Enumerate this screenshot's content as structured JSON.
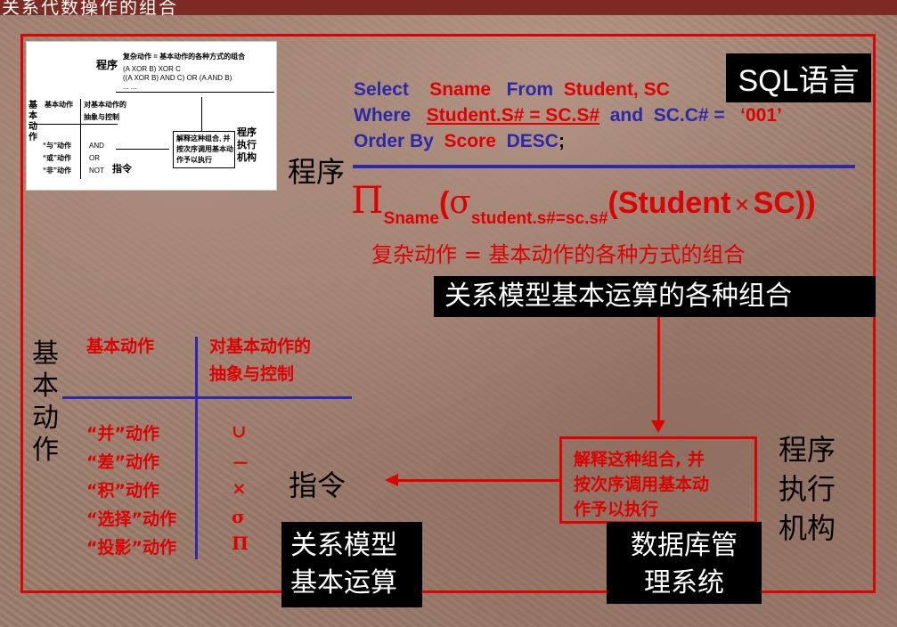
{
  "title_bar": "关系代数操作的组合",
  "sql_badge": "SQL语言",
  "sql": {
    "line1": {
      "k1": "Select",
      "v1": "Sname",
      "k2": "From",
      "v2": "Student, SC"
    },
    "line2": {
      "k1": "Where",
      "v1": "Student.S# = SC.S#",
      "k2": "and",
      "v2": "SC.C# =",
      "v3": "‘001’"
    },
    "line3": {
      "k1": "Order By",
      "v1": "Score",
      "k2": "DESC",
      "end": ";"
    }
  },
  "program_label": "程序",
  "formula": {
    "pi": "Π",
    "pi_sub": "Sname",
    "open": "(",
    "sigma": "σ",
    "sigma_sub": "student.s#=sc.s#",
    "inner_open": "(Student",
    "times": "×",
    "inner_close": "SC))"
  },
  "complex_action": "复杂动作 = 基本动作的各种方式的组合",
  "relational_combination": "关系模型基本运算的各种组合",
  "interpret_box": [
    "解释这种组合, 并",
    "按次序调用基本动",
    "作予以执行"
  ],
  "exec_org": [
    "程序",
    "执行",
    "机构"
  ],
  "instruction": "指令",
  "dbms": [
    "数据库管",
    "理系统"
  ],
  "rel_basic_ops": [
    "关系模型",
    "基本运算"
  ],
  "basic_action_vertical": [
    "基",
    "本",
    "动",
    "作"
  ],
  "table_header_left": "基本动作",
  "table_header_right": [
    "对基本动作的",
    "抽象与控制"
  ],
  "ops": [
    {
      "name": "“并”动作",
      "symbol": "∪"
    },
    {
      "name": "“差”动作",
      "symbol": "－"
    },
    {
      "name": "“积”动作",
      "symbol": "×"
    },
    {
      "name": "“选择”动作",
      "symbol": "σ"
    },
    {
      "name": "“投影”动作",
      "symbol": "Π"
    }
  ],
  "thumbnail": {
    "program": "程序",
    "complex": "复杂动作 = 基本动作的各种方式的组合",
    "combo1": "(A XOR B) XOR C",
    "combo2": "((A XOR B) AND C) OR (A AND B)",
    "dots": "... ...",
    "basic": "基本动作",
    "abstract": [
      "对基本动作的",
      "抽象与控制"
    ],
    "vertical": [
      "基",
      "本",
      "动",
      "作"
    ],
    "and_action": "“与”动作",
    "or_action": "“或”动作",
    "not_action": "“非”动作",
    "and": "AND",
    "or": "OR",
    "not": "NOT",
    "instruction": "指令",
    "interpret": [
      "解释这种组合, 并",
      "按次序调用基本动",
      "作予以执行"
    ],
    "exec": [
      "程序",
      "执行",
      "机构"
    ]
  }
}
